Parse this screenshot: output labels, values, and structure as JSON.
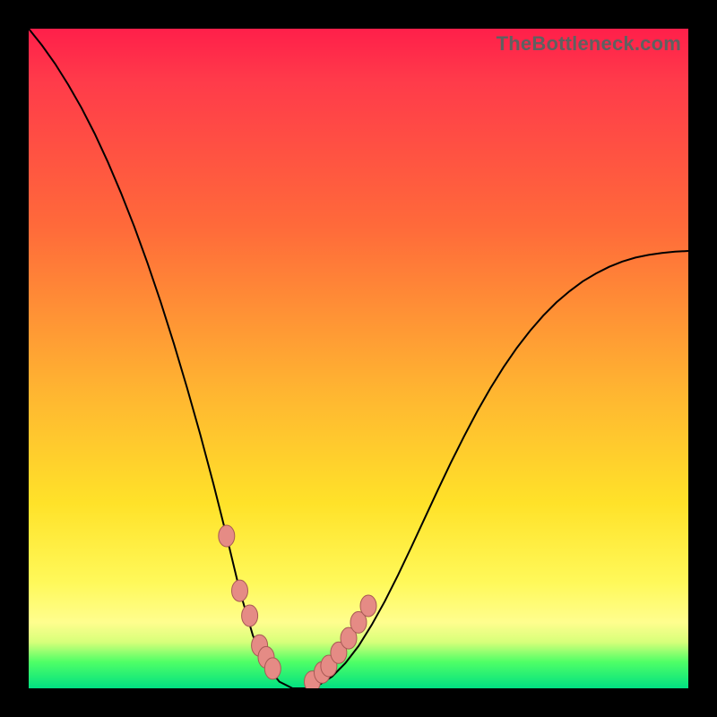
{
  "watermark": "TheBottleneck.com",
  "colors": {
    "frame_bg": "#000000",
    "gradient_top": "#ff1f4a",
    "gradient_mid": "#ffe229",
    "gradient_bottom": "#00e082",
    "curve_stroke": "#000000",
    "marker_fill": "#e58b85",
    "marker_stroke": "#a85a55"
  },
  "chart_data": {
    "type": "line",
    "title": "",
    "xlabel": "",
    "ylabel": "",
    "xlim": [
      0,
      100
    ],
    "ylim": [
      0,
      100
    ],
    "x": [
      0,
      2,
      4,
      6,
      8,
      10,
      12,
      14,
      16,
      18,
      20,
      22,
      24,
      26,
      28,
      30,
      32,
      34,
      36,
      38,
      40,
      42,
      44,
      46,
      48,
      50,
      52,
      54,
      56,
      58,
      60,
      62,
      64,
      66,
      68,
      70,
      72,
      74,
      76,
      78,
      80,
      82,
      84,
      86,
      88,
      90,
      92,
      94,
      96,
      98,
      100
    ],
    "y": [
      100,
      97.5,
      94.7,
      91.5,
      88.0,
      84.1,
      79.8,
      75.1,
      70.0,
      64.5,
      58.6,
      52.3,
      45.6,
      38.5,
      31.0,
      23.1,
      14.8,
      8.0,
      3.5,
      1.0,
      0.0,
      0.0,
      0.5,
      1.8,
      3.8,
      6.4,
      9.6,
      13.2,
      17.2,
      21.4,
      25.7,
      30.0,
      34.2,
      38.2,
      42.0,
      45.5,
      48.7,
      51.6,
      54.2,
      56.5,
      58.5,
      60.2,
      61.7,
      62.9,
      63.9,
      64.7,
      65.3,
      65.7,
      66.0,
      66.2,
      66.3
    ],
    "markers_left": {
      "x": [
        30,
        32,
        33.5,
        35,
        36,
        37
      ],
      "y": [
        23.1,
        14.8,
        11.0,
        6.5,
        4.7,
        3.0
      ]
    },
    "markers_right": {
      "x": [
        43,
        44.5,
        45.5,
        47,
        48.5,
        50,
        51.5
      ],
      "y": [
        1.0,
        2.4,
        3.4,
        5.4,
        7.6,
        10.0,
        12.5
      ]
    },
    "legend": []
  }
}
